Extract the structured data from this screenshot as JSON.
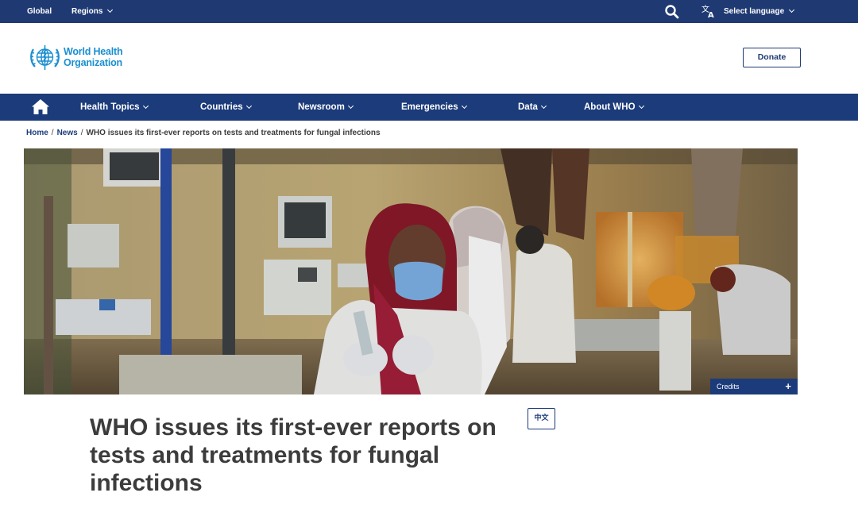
{
  "topbar": {
    "global_label": "Global",
    "regions_label": "Regions",
    "search_icon": "search-icon",
    "language_icon": "translate-icon",
    "language_label": "Select language"
  },
  "header": {
    "logo_line1": "World Health",
    "logo_line2": "Organization",
    "donate_label": "Donate"
  },
  "nav": {
    "home_icon": "home-icon",
    "items": [
      {
        "label": "Health Topics"
      },
      {
        "label": "Countries"
      },
      {
        "label": "Newsroom"
      },
      {
        "label": "Emergencies"
      },
      {
        "label": "Data"
      },
      {
        "label": "About WHO"
      }
    ]
  },
  "breadcrumb": {
    "home": "Home",
    "news": "News",
    "current": "WHO issues its first-ever reports on tests and treatments for fungal infections"
  },
  "hero": {
    "credits_label": "Credits",
    "credits_toggle": "+"
  },
  "article": {
    "title": "WHO issues its first-ever reports on tests and treatments for fungal infections",
    "language_button": "中文"
  },
  "colors": {
    "brand_navy": "#1c3b7a",
    "who_blue": "#1a8fd1",
    "text_dark": "#3c3c3c"
  }
}
